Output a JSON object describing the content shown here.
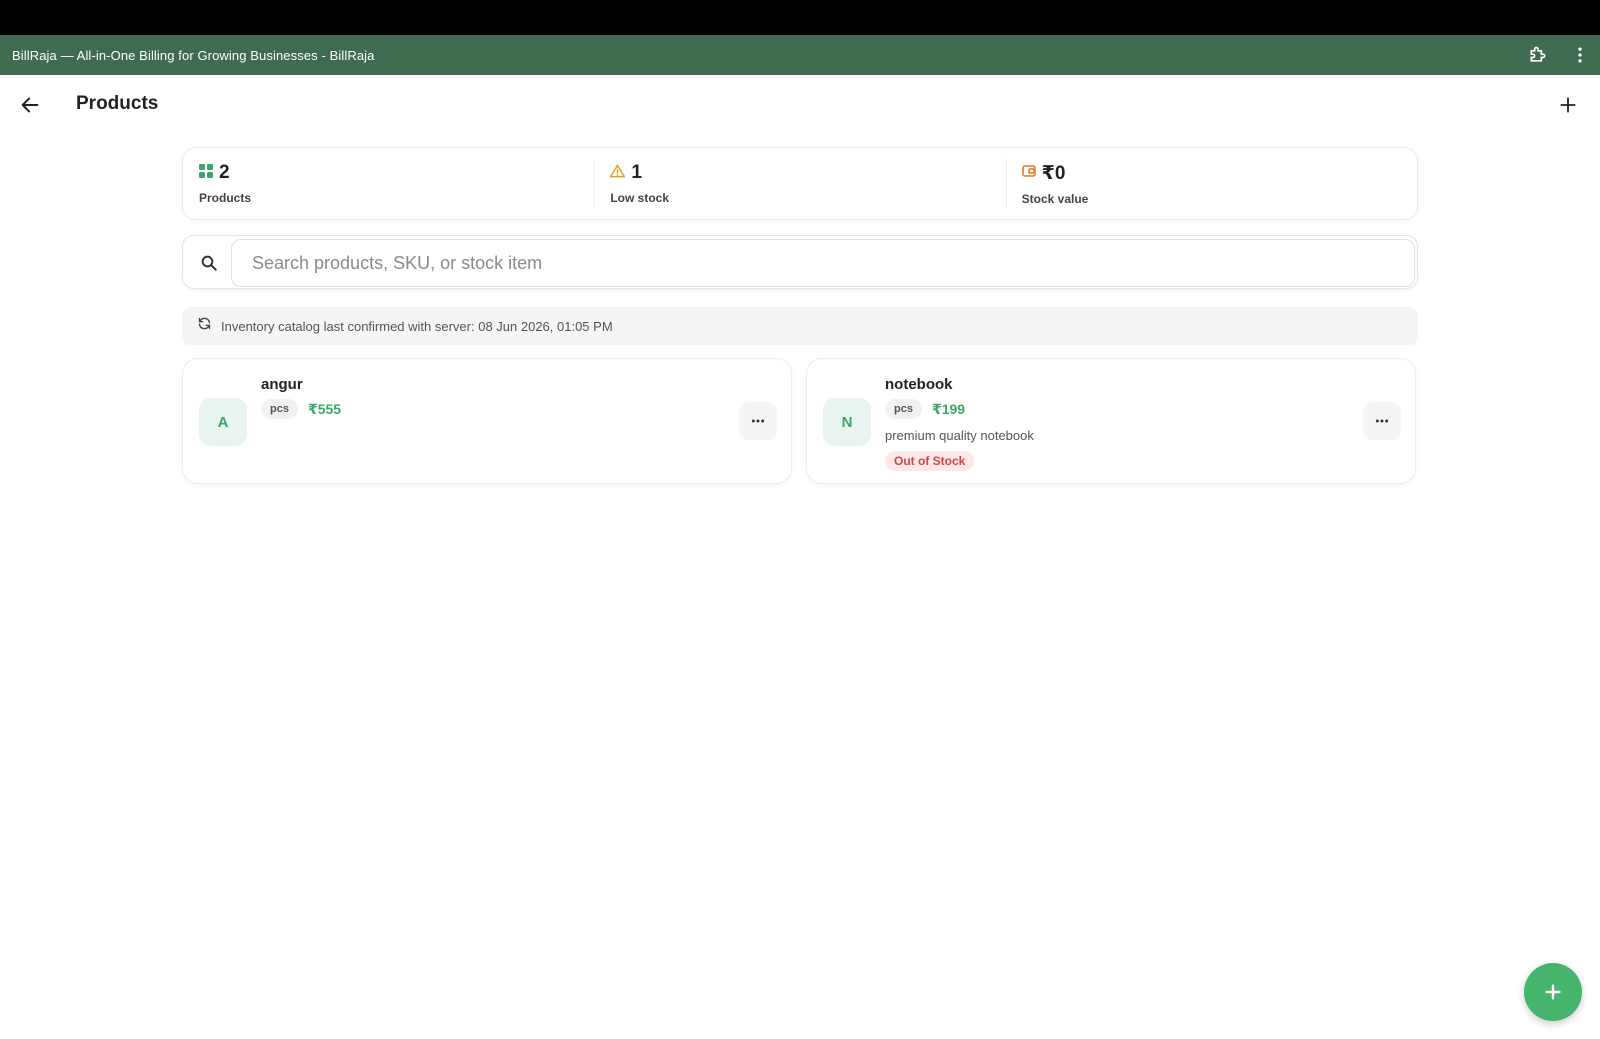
{
  "window": {
    "title": "BillRaja — All-in-One Billing for Growing Businesses - BillRaja"
  },
  "appbar": {
    "title": "Products"
  },
  "stats": [
    {
      "value": "2",
      "label": "Products",
      "icon": "grid-icon",
      "color": "#3da56a"
    },
    {
      "value": "1",
      "label": "Low stock",
      "icon": "warning-icon",
      "color": "#e0a023"
    },
    {
      "value": "₹0",
      "label": "Stock value",
      "icon": "wallet-icon",
      "color": "#e8893a"
    }
  ],
  "search": {
    "placeholder": "Search products, SKU, or stock item"
  },
  "sync": {
    "text": "Inventory catalog last confirmed with server: 08 Jun 2026, 01:05 PM"
  },
  "products": [
    {
      "initial": "A",
      "name": "angur",
      "unit": "pcs",
      "price": "₹555",
      "description": "",
      "status": ""
    },
    {
      "initial": "N",
      "name": "notebook",
      "unit": "pcs",
      "price": "₹199",
      "description": "premium quality notebook",
      "status": "Out of Stock"
    }
  ],
  "colors": {
    "titlebar": "#3f6b51",
    "accent": "#45b46c",
    "danger": "#d24545"
  }
}
